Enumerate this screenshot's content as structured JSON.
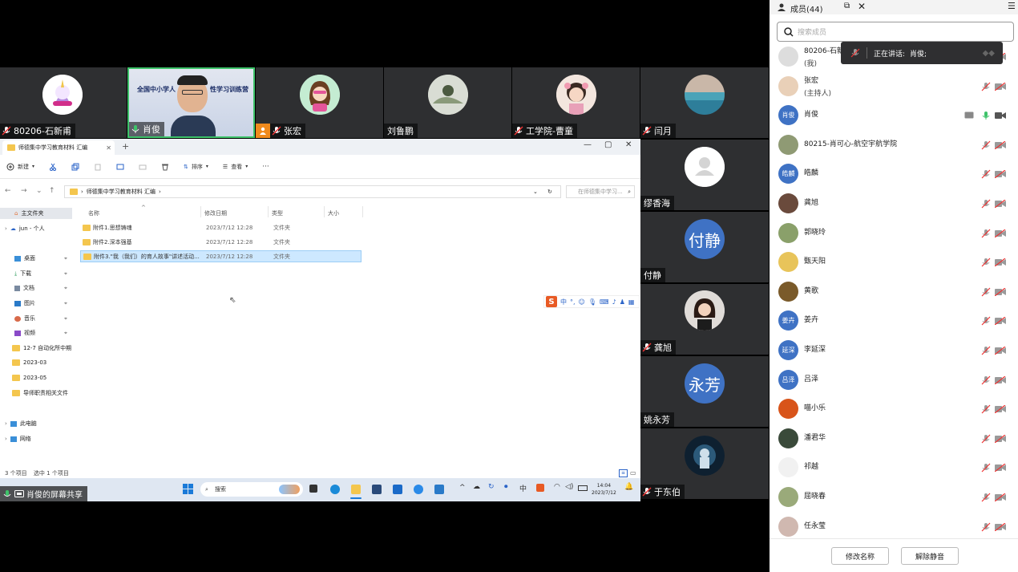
{
  "tiles": [
    {
      "name": "80206-石新甫",
      "mic": "off"
    },
    {
      "name": "肖俊",
      "mic": "on",
      "slide_text_left": "全国中小学人",
      "slide_text_right": "性学习训练营"
    },
    {
      "name": "张宏",
      "mic": "off"
    },
    {
      "name": "刘鲁鹏",
      "mic": "none"
    },
    {
      "name": "工学院-曹童",
      "mic": "off"
    },
    {
      "name": "闫月",
      "mic": "off"
    },
    {
      "name": "缪香海",
      "mic": "none"
    },
    {
      "name": "付静",
      "mic": "none",
      "initials": "付静"
    },
    {
      "name": "龚旭",
      "mic": "off"
    },
    {
      "name": "姚永芳",
      "mic": "none",
      "initials": "永芳"
    },
    {
      "name": "于东伯",
      "mic": "off"
    }
  ],
  "explorer": {
    "tab_title": "师德集中学习教育材料 汇编",
    "toolbar": {
      "new": "新建",
      "sort": "排序",
      "view": "查看",
      "more": "···"
    },
    "address_path": "师德集中学习教育材料 汇编",
    "search_placeholder": "在师德集中学习...",
    "sidebar": [
      {
        "label": "主文件夹",
        "kind": "home"
      },
      {
        "label": "jun - 个人",
        "kind": "cloud"
      },
      {
        "label": "桌面",
        "kind": "desktop"
      },
      {
        "label": "下载",
        "kind": "download"
      },
      {
        "label": "文档",
        "kind": "docs"
      },
      {
        "label": "图片",
        "kind": "pics"
      },
      {
        "label": "音乐",
        "kind": "music"
      },
      {
        "label": "视频",
        "kind": "video"
      },
      {
        "label": "12-7 自动化所中期",
        "kind": "folder"
      },
      {
        "label": "2023-03",
        "kind": "folder"
      },
      {
        "label": "2023-05",
        "kind": "folder"
      },
      {
        "label": "导师职责相关文件",
        "kind": "folder"
      },
      {
        "label": "此电脑",
        "kind": "pc"
      },
      {
        "label": "网络",
        "kind": "net"
      }
    ],
    "columns": {
      "name": "名称",
      "modified": "修改日期",
      "type": "类型",
      "size": "大小"
    },
    "files": [
      {
        "name": "附件1.思想铸魂",
        "modified": "2023/7/12 12:28",
        "type": "文件夹",
        "selected": false
      },
      {
        "name": "附件2.深本强基",
        "modified": "2023/7/12 12:28",
        "type": "文件夹",
        "selected": false
      },
      {
        "name": "附件3.\"我（我们）的育人故事\"讲述活动...",
        "modified": "2023/7/12 12:28",
        "type": "文件夹",
        "selected": true
      }
    ],
    "status_count": "3 个项目",
    "status_selected": "选中 1 个项目"
  },
  "ime": {
    "label": "中"
  },
  "taskbar": {
    "search": "搜索",
    "time": "14:04",
    "date": "2023/7/12"
  },
  "share_label": "肖俊的屏幕共享",
  "panel": {
    "title": "成员(44)",
    "search_placeholder": "搜索成员",
    "speaking_label": "正在讲话:",
    "speaking_name": "肖俊;",
    "members": [
      {
        "name": "80206-石新甫",
        "sub": "(我)",
        "avatar": "img",
        "color": "#ddd",
        "mic": "off",
        "cam": "off"
      },
      {
        "name": "张宏",
        "sub": "(主持人)",
        "avatar": "img",
        "color": "#e9d0b8",
        "mic": "off",
        "cam": "off"
      },
      {
        "name": "肖俊",
        "sub": "",
        "avatar": "肖俊",
        "color": "#3f72c4",
        "mic": "on",
        "cam": "on"
      },
      {
        "name": "80215-肖可心-航空宇航学院",
        "sub": "",
        "avatar": "img",
        "color": "#8f9a74",
        "mic": "off",
        "cam": "off"
      },
      {
        "name": "皓麟",
        "sub": "",
        "avatar": "皓麟",
        "color": "#3f72c4",
        "mic": "off",
        "cam": "off"
      },
      {
        "name": "龚旭",
        "sub": "",
        "avatar": "img",
        "color": "#6a4a3c",
        "mic": "off",
        "cam": "off"
      },
      {
        "name": "郭晓玲",
        "sub": "",
        "avatar": "img",
        "color": "#8aa06a",
        "mic": "off",
        "cam": "off"
      },
      {
        "name": "甄天阳",
        "sub": "",
        "avatar": "img",
        "color": "#e8c45a",
        "mic": "off",
        "cam": "off"
      },
      {
        "name": "黄歌",
        "sub": "",
        "avatar": "img",
        "color": "#7a5a2a",
        "mic": "off",
        "cam": "off"
      },
      {
        "name": "姜卉",
        "sub": "",
        "avatar": "姜卉",
        "color": "#3f72c4",
        "mic": "off",
        "cam": "off"
      },
      {
        "name": "李延深",
        "sub": "",
        "avatar": "延深",
        "color": "#3f72c4",
        "mic": "off",
        "cam": "off"
      },
      {
        "name": "吕泽",
        "sub": "",
        "avatar": "吕泽",
        "color": "#3f72c4",
        "mic": "off",
        "cam": "off"
      },
      {
        "name": "喵小乐",
        "sub": "",
        "avatar": "img",
        "color": "#d8541a",
        "mic": "off",
        "cam": "off"
      },
      {
        "name": "潘君华",
        "sub": "",
        "avatar": "img",
        "color": "#3a4a3a",
        "mic": "off",
        "cam": "off"
      },
      {
        "name": "祁越",
        "sub": "",
        "avatar": "img",
        "color": "#f1f1f1",
        "mic": "off",
        "cam": "off"
      },
      {
        "name": "屈晓春",
        "sub": "",
        "avatar": "img",
        "color": "#9aaa7a",
        "mic": "off",
        "cam": "off"
      },
      {
        "name": "任永莹",
        "sub": "",
        "avatar": "img",
        "color": "#d0b8b0",
        "mic": "off",
        "cam": "off"
      }
    ],
    "rename_button": "修改名称",
    "unmute_button": "解除静音"
  }
}
